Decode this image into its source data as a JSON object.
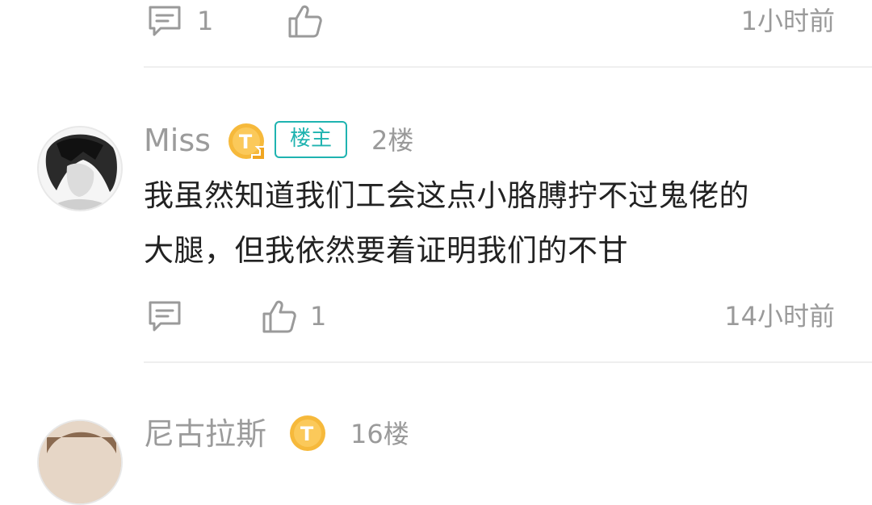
{
  "colors": {
    "accent": "#1fb3b0",
    "text_primary": "#222222",
    "text_secondary": "#9a9a9a",
    "level_badge": "#f6b93b"
  },
  "top_comment": {
    "reply_count": "1",
    "like_count": "",
    "time": "1小时前",
    "icons": {
      "reply": "comment-icon",
      "like": "thumbs-up-icon"
    }
  },
  "comment_2": {
    "username": "Miss",
    "level_badge": "T",
    "op_badge": "楼主",
    "floor": "2楼",
    "text_line1": "我虽然知道我们工会这点小胳膊拧不过鬼佬的",
    "text_line2": "大腿，但我依然要着证明我们的不甘",
    "reply_count": "",
    "like_count": "1",
    "time": "14小时前",
    "icons": {
      "reply": "comment-icon",
      "like": "thumbs-up-icon"
    }
  },
  "comment_3": {
    "username": "尼古拉斯",
    "level_badge": "T",
    "floor": "16楼"
  }
}
